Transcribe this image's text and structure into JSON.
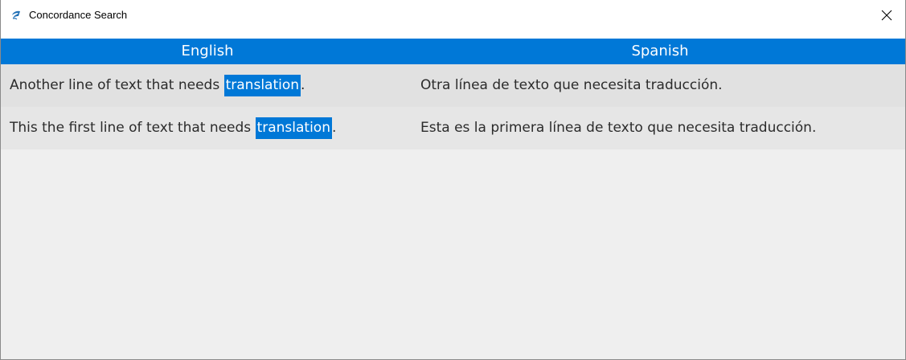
{
  "window": {
    "title": "Concordance Search",
    "close_icon": "close-icon",
    "app_icon": "app-logo-icon"
  },
  "table": {
    "columns": [
      {
        "label": "English"
      },
      {
        "label": "Spanish"
      }
    ],
    "rows": [
      {
        "english": {
          "before": "Another line of text that needs ",
          "match": "translation",
          "after": "."
        },
        "spanish": "Otra línea de texto que necesita traducción."
      },
      {
        "english": {
          "before": "This the first line of text that needs ",
          "match": "translation",
          "after": "."
        },
        "spanish": "Esta es la primera línea de texto que necesita traducción."
      }
    ]
  },
  "colors": {
    "accent": "#0078d7",
    "row_alt": "#e1e1e1",
    "background": "#efefef"
  }
}
